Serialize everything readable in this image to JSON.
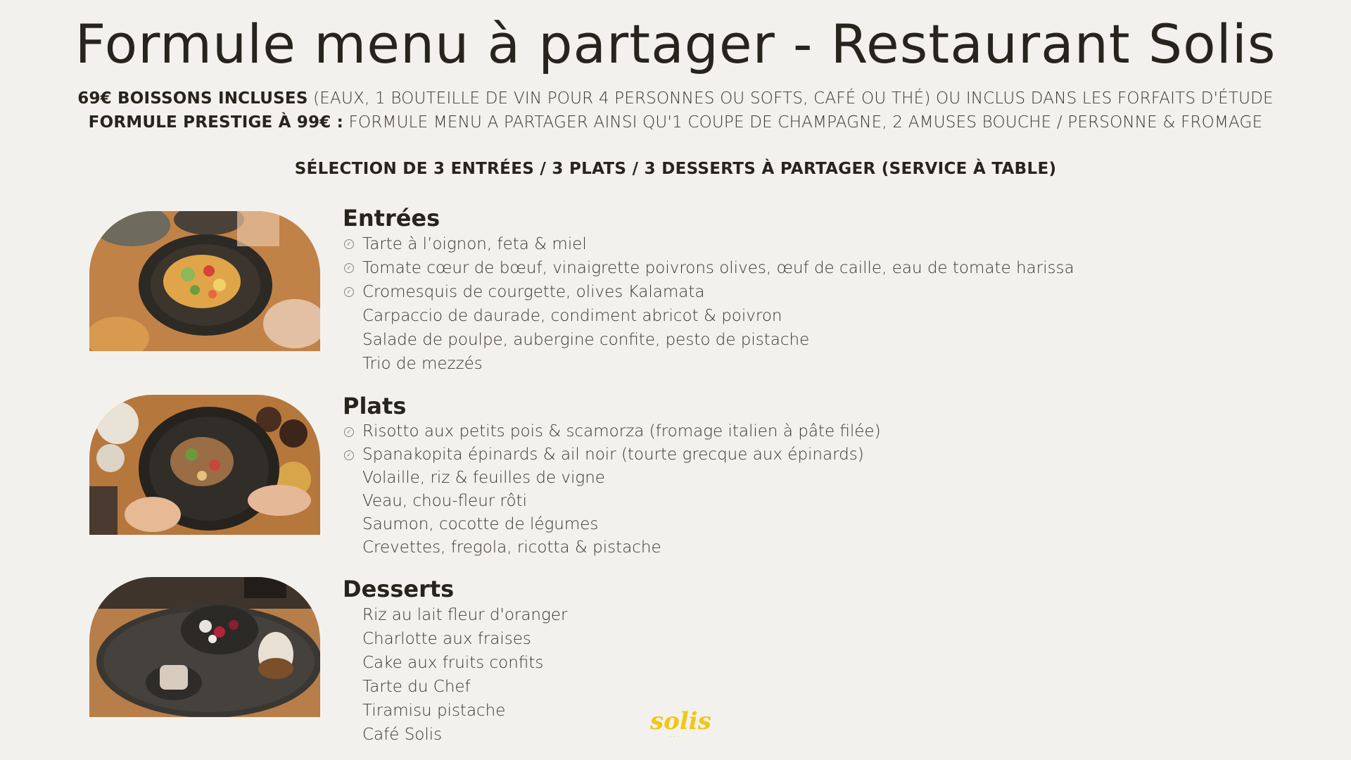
{
  "title": "Formule menu à partager - Restaurant Solis",
  "subtitle1": {
    "bold": "69€ BOISSONS INCLUSES",
    "rest": " (EAUX, 1 BOUTEILLE DE VIN POUR 4 PERSONNES OU SOFTS, CAFÉ OU THÉ) OU INCLUS DANS LES FORFAITS D'ÉTUDE"
  },
  "subtitle2": {
    "bold": "FORMULE PRESTIGE À 99€ :",
    "rest": " FORMULE MENU A PARTAGER AINSI QU'1 COUPE DE CHAMPAGNE, 2 AMUSES BOUCHE / PERSONNE & FROMAGE"
  },
  "selection": "SÉLECTION DE 3 ENTRÉES / 3 PLATS / 3 DESSERTS À PARTAGER (SERVICE À TABLE)",
  "entrees": {
    "heading": "Entrées",
    "items": [
      {
        "label": "Tarte à l’oignon, feta & miel",
        "vegetarian": true
      },
      {
        "label": "Tomate cœur de bœuf, vinaigrette poivrons olives, œuf de caille, eau de tomate harissa",
        "vegetarian": true
      },
      {
        "label": "Cromesquis de courgette, olives Kalamata",
        "vegetarian": true
      },
      {
        "label": "Carpaccio de daurade, condiment abricot & poivron",
        "vegetarian": false
      },
      {
        "label": "Salade de poulpe, aubergine confite, pesto de pistache",
        "vegetarian": false
      },
      {
        "label": "Trio de mezzés",
        "vegetarian": false
      }
    ]
  },
  "plats": {
    "heading": "Plats",
    "items": [
      {
        "label": "Risotto aux petits pois & scamorza (fromage italien à pâte filée)",
        "vegetarian": true
      },
      {
        "label": "Spanakopita épinards & ail noir (tourte grecque aux épinards)",
        "vegetarian": true
      },
      {
        "label": "Volaille, riz & feuilles de vigne",
        "vegetarian": false
      },
      {
        "label": "Veau, chou-fleur rôti",
        "vegetarian": false
      },
      {
        "label": "Saumon, cocotte de légumes",
        "vegetarian": false
      },
      {
        "label": "Crevettes, fregola, ricotta & pistache",
        "vegetarian": false
      }
    ]
  },
  "desserts": {
    "heading": "Desserts",
    "items": [
      {
        "label": "Riz au lait fleur d'oranger",
        "vegetarian": false
      },
      {
        "label": "Charlotte aux fraises",
        "vegetarian": false
      },
      {
        "label": "Cake aux fruits confits",
        "vegetarian": false
      },
      {
        "label": "Tarte du Chef",
        "vegetarian": false
      },
      {
        "label": "Tiramisu pistache",
        "vegetarian": false
      },
      {
        "label": "Café Solis",
        "vegetarian": false
      }
    ]
  },
  "logo": {
    "text": "solis"
  },
  "colors": {
    "background": "#f3f1ed",
    "text": "#27231d",
    "logo": "#f2c614"
  },
  "icons": {
    "vegetarian": "vegetarian-leaf-icon"
  }
}
